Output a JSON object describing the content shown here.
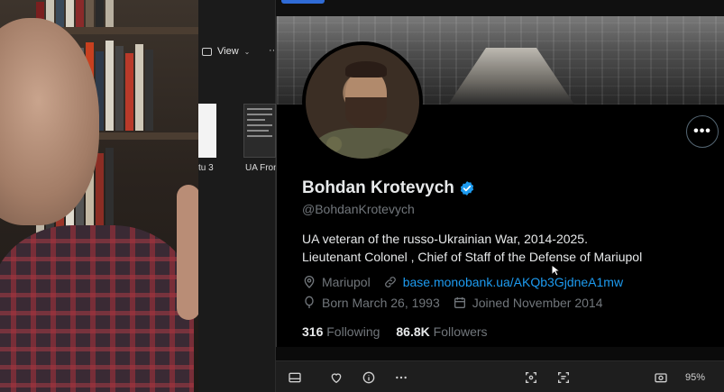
{
  "explorer": {
    "view_label": "View",
    "thumb_labels": [
      "tu 3",
      "UA Fron"
    ]
  },
  "profile": {
    "name": "Bohdan Krotevych",
    "handle": "@BohdanKrotevych",
    "bio_line1": "UA veteran of the russo-Ukrainian War, 2014-2025.",
    "bio_line2": "Lieutenant Colonel , Chief of Staff of the Defense of Mariupol",
    "location": "Mariupol",
    "link": "base.monobank.ua/AKQb3GjdneA1mw",
    "born": "Born March 26, 1993",
    "joined": "Joined November 2014",
    "following_count": "316",
    "following_label": "Following",
    "followers_count": "86.8K",
    "followers_label": "Followers",
    "more_label": "•••"
  },
  "toolbar": {
    "zoom": "95%",
    "icons": [
      "slideshow-icon",
      "heart-icon",
      "info-icon",
      "more-icon",
      "crop-icon",
      "text-scan-icon",
      "camera-icon"
    ]
  },
  "colors": {
    "accent_link": "#1d9bf0",
    "verified": "#1d9bf0",
    "secondary_text": "#71767b"
  }
}
